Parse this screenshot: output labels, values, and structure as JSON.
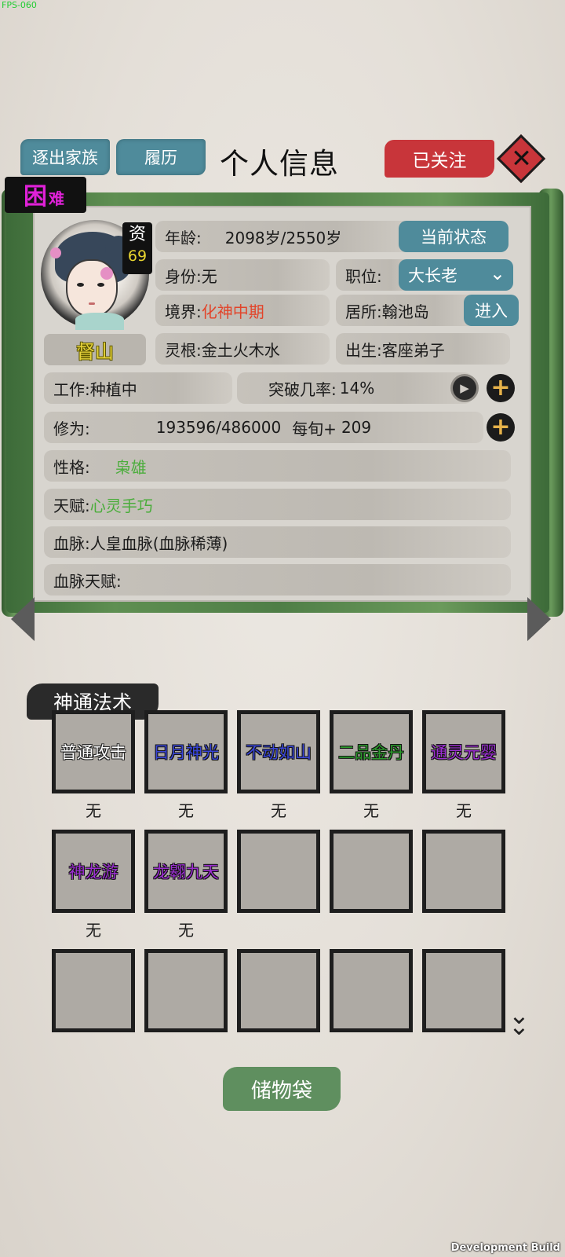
{
  "debug": {
    "fps": "FPS-060",
    "build": "Development Build"
  },
  "header": {
    "expel_label": "逐出家族",
    "history_label": "履历",
    "title": "个人信息",
    "follow_label": "已关注",
    "close_icon": "close-icon"
  },
  "profile": {
    "difficulty_main": "困",
    "difficulty_sub": "难",
    "aptitude_label": "资",
    "aptitude_value": "69",
    "name": "督山",
    "age_label": "年龄:",
    "age_value": "2098岁/2550岁",
    "status_button": "当前状态",
    "identity_label": "身份:",
    "identity_value": "无",
    "post_label": "职位:",
    "post_value": "大长老",
    "realm_label": "境界:",
    "realm_value": "化神中期",
    "residence_label": "居所:",
    "residence_value": "翰池岛",
    "enter_button": "进入",
    "root_label": "灵根:",
    "root_value": "金土火木水",
    "origin_label": "出生:",
    "origin_value": "客座弟子",
    "work_label": "工作:",
    "work_value": "种植中",
    "breakthrough_label": "突破几率:",
    "breakthrough_value": "14%",
    "cultivation_label": "修为:",
    "cultivation_value": "193596/486000",
    "per_turn_label": "每旬+",
    "per_turn_value": "209",
    "personality_label": "性格:",
    "personality_value": "枭雄",
    "talent_label": "天赋:",
    "talent_value": "心灵手巧",
    "bloodline_label": "血脉:",
    "bloodline_value": "人皇血脉(血脉稀薄)",
    "bloodline_talent_label": "血脉天赋:",
    "bloodline_talent_value": ""
  },
  "skills": {
    "header": "神通法术",
    "slots": [
      {
        "name": "普通攻击",
        "level": "无",
        "color": "#ffffff"
      },
      {
        "name": "日月神光",
        "level": "无",
        "color": "#3a46d8"
      },
      {
        "name": "不动如山",
        "level": "无",
        "color": "#3a46d8"
      },
      {
        "name": "二品金丹",
        "level": "无",
        "color": "#2c9a2c"
      },
      {
        "name": "通灵元婴",
        "level": "无",
        "color": "#9b2fd0"
      },
      {
        "name": "神龙游",
        "level": "无",
        "color": "#9b2fd0"
      },
      {
        "name": "龙翱九天",
        "level": "无",
        "color": "#9b2fd0"
      },
      {
        "name": "",
        "level": ""
      },
      {
        "name": "",
        "level": ""
      },
      {
        "name": "",
        "level": ""
      },
      {
        "name": "",
        "level": ""
      },
      {
        "name": "",
        "level": ""
      },
      {
        "name": "",
        "level": ""
      },
      {
        "name": "",
        "level": ""
      },
      {
        "name": "",
        "level": ""
      }
    ]
  },
  "storage_button": "储物袋"
}
